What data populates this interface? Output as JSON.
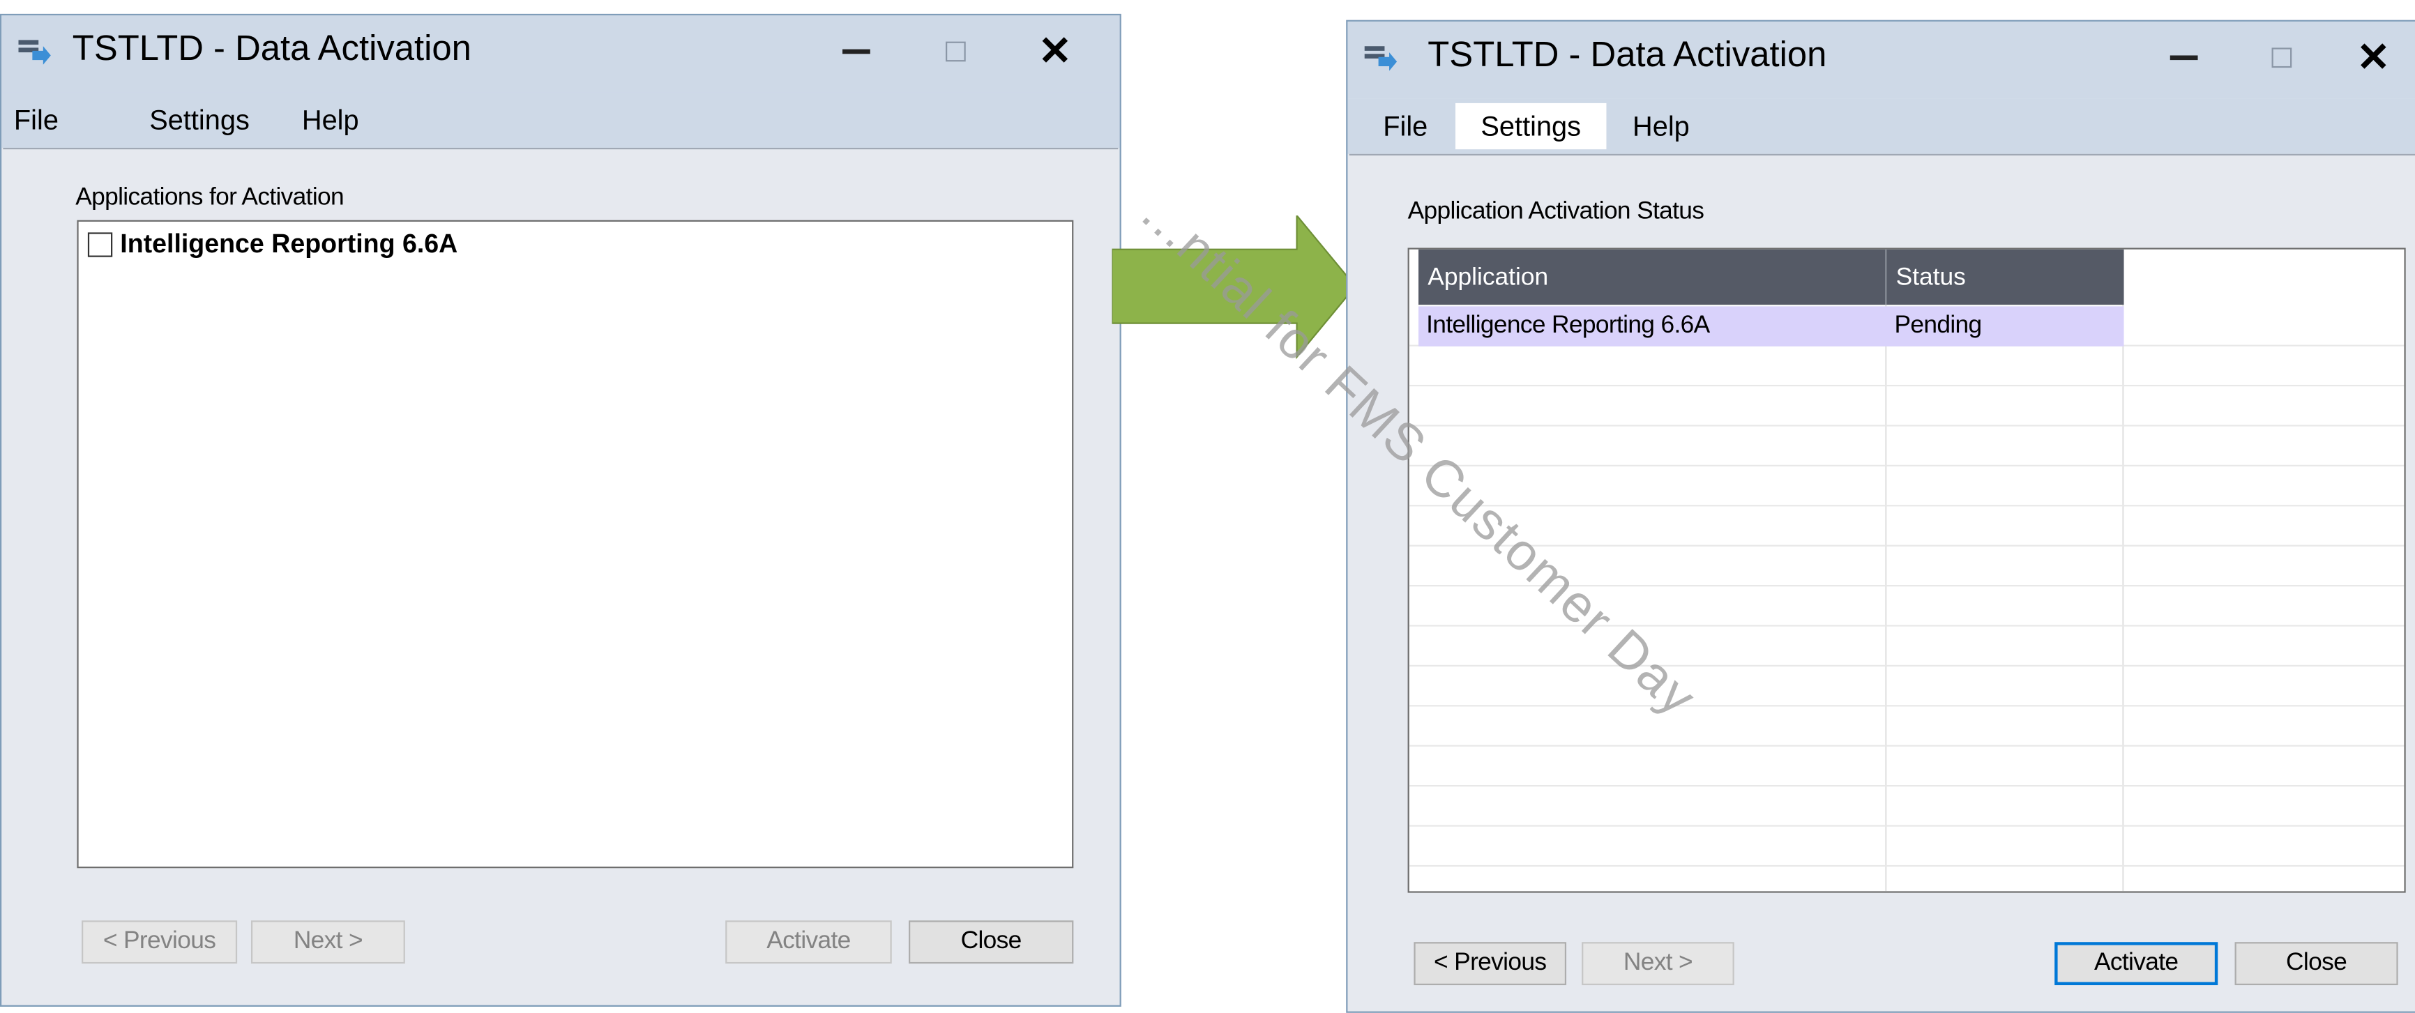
{
  "left_window": {
    "title": "TSTLTD - Data Activation",
    "menu": [
      "File",
      "Settings",
      "Help"
    ],
    "group_label": "Applications for Activation",
    "items": [
      {
        "label": "Intelligence Reporting 6.6A",
        "checked": false
      }
    ],
    "buttons": {
      "previous": "< Previous",
      "next": "Next >",
      "activate": "Activate",
      "close": "Close"
    }
  },
  "right_window": {
    "title": "TSTLTD - Data Activation",
    "menu": [
      "File",
      "Settings",
      "Help"
    ],
    "active_menu": "Settings",
    "group_label": "Application Activation Status",
    "columns": [
      "Application",
      "Status"
    ],
    "rows": [
      {
        "application": "Intelligence Reporting 6.6A",
        "status": "Pending"
      }
    ],
    "buttons": {
      "previous": "< Previous",
      "next": "Next >",
      "activate": "Activate",
      "close": "Close"
    }
  },
  "watermark": "...ntial for FMS Customer Day",
  "colors": {
    "arrow": "#8db34a",
    "titlebar": "#ced9e7",
    "grid_header": "#555a66",
    "selected_row": "#d9d2fb",
    "default_button_border": "#0078d7"
  },
  "icons": [
    "app-icon",
    "minimize-icon",
    "maximize-icon",
    "close-icon",
    "arrow-icon",
    "checkbox-icon"
  ]
}
